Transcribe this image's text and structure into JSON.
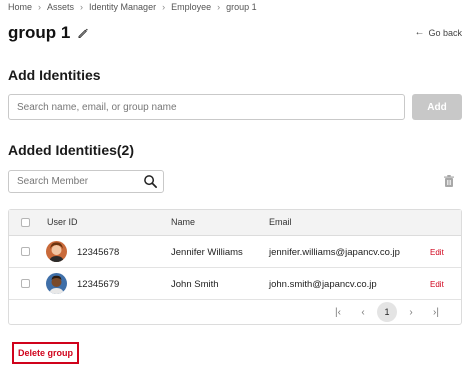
{
  "breadcrumb": [
    "Home",
    "Assets",
    "Identity Manager",
    "Employee",
    "group 1"
  ],
  "page": {
    "title": "group 1",
    "go_back": "Go back"
  },
  "add_identities": {
    "heading": "Add Identities",
    "search_placeholder": "Search name, email, or group name",
    "add_label": "Add"
  },
  "added_identities": {
    "heading": "Added Identities(2)",
    "member_search_placeholder": "Search Member"
  },
  "table": {
    "headers": {
      "user_id": "User ID",
      "name": "Name",
      "email": "Email"
    },
    "rows": [
      {
        "user_id": "12345678",
        "name": "Jennifer Williams",
        "email": "jennifer.williams@japancv.co.jp",
        "action": "Edit"
      },
      {
        "user_id": "12345679",
        "name": "John Smith",
        "email": "john.smith@japancv.co.jp",
        "action": "Edit"
      }
    ]
  },
  "pagination": {
    "current_page": "1"
  },
  "actions": {
    "delete_group": "Delete group"
  },
  "colors": {
    "danger": "#d0021b",
    "disabled_button": "#c8c8c8",
    "header_bg": "#f3f3f3"
  }
}
